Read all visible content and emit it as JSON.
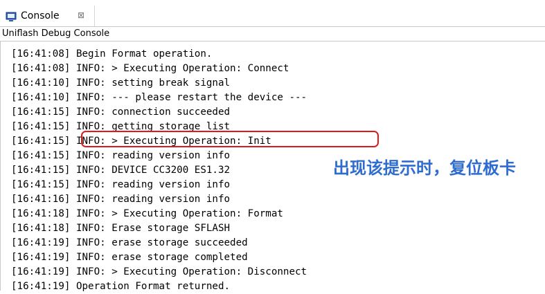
{
  "tab": {
    "title": "Console",
    "icon": "console-icon",
    "close": "⊠"
  },
  "header": {
    "title": "Uniflash Debug Console"
  },
  "console": {
    "lines": [
      "[16:41:08] Begin Format operation.",
      "[16:41:08] INFO: > Executing Operation: Connect",
      "[16:41:10] INFO: setting break signal",
      "[16:41:10] INFO: --- please restart the device ---",
      "[16:41:15] INFO: connection succeeded",
      "[16:41:15] INFO: getting storage list",
      "[16:41:15] INFO: > Executing Operation: Init",
      "[16:41:15] INFO: reading version info",
      "[16:41:15] INFO: DEVICE CC3200 ES1.32",
      "[16:41:15] INFO: reading version info",
      "[16:41:16] INFO: reading version info",
      "[16:41:18] INFO: > Executing Operation: Format",
      "[16:41:18] INFO: Erase storage SFLASH",
      "[16:41:19] INFO: erase storage succeeded",
      "[16:41:19] INFO: erase storage completed",
      "[16:41:19] INFO: > Executing Operation: Disconnect",
      "[16:41:19] Operation Format returned."
    ]
  },
  "annotation": {
    "text": "出现该提示时，复位板卡",
    "color": "#2f6cd0"
  },
  "colors": {
    "highlight": "#e01818",
    "annotation": "#2f6cd0"
  }
}
